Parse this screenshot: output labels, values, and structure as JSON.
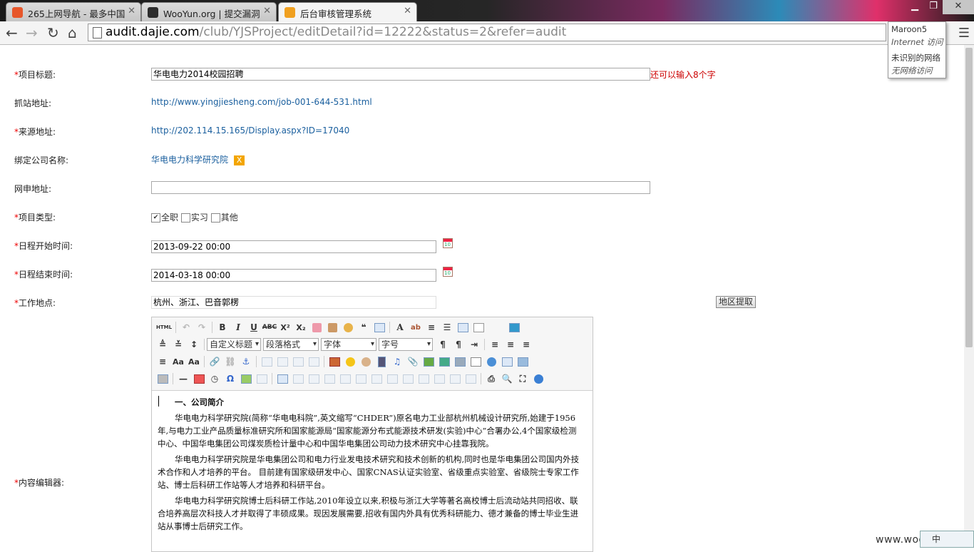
{
  "browser": {
    "tabs": [
      {
        "title": "265上网导航 - 最多中国",
        "favicon_color": "#e7562a"
      },
      {
        "title": "WooYun.org | 提交漏洞",
        "favicon_color": "#2c2c2c"
      },
      {
        "title": "后台审核管理系统",
        "favicon_color": "#f0a020"
      }
    ],
    "url_host": "audit.dajie.com",
    "url_path": "/club/YJSProject/editDetail?id=12222&status=2&refer=audit",
    "network_popup": {
      "line1": "Maroon5",
      "line2": "Internet 访问",
      "line3": "未识别的网络",
      "line4": "无网络访问"
    }
  },
  "form": {
    "title": {
      "label": "项目标题:",
      "value": "华电电力2014校园招聘",
      "hint": "还可以输入8个字"
    },
    "crawl": {
      "label": "抓站地址:",
      "value": "http://www.yingjiesheng.com/job-001-644-531.html"
    },
    "source": {
      "label": "来源地址:",
      "value": "http://202.114.15.165/Display.aspx?ID=17040"
    },
    "company": {
      "label": "绑定公司名称:",
      "value": "华电电力科学研究院",
      "remove": "X"
    },
    "apply": {
      "label": "网申地址:",
      "value": ""
    },
    "type": {
      "label": "项目类型:",
      "options": [
        {
          "label": "全职",
          "checked": true
        },
        {
          "label": "实习",
          "checked": false
        },
        {
          "label": "其他",
          "checked": false
        }
      ]
    },
    "start": {
      "label": "日程开始时间:",
      "value": "2013-09-22 00:00"
    },
    "end": {
      "label": "日程结束时间:",
      "value": "2014-03-18 00:00"
    },
    "location": {
      "label": "工作地点:",
      "value": "杭州、浙江、巴音郭楞",
      "button": "地区提取"
    },
    "content": {
      "label": "内容编辑器:"
    }
  },
  "editor": {
    "selects": [
      "自定义标题",
      "段落格式",
      "字体",
      "字号"
    ],
    "html_label": "HTML",
    "heading": "一、公司简介",
    "paragraphs": [
      "华电电力科学研究院(简称“华电电科院”,英文缩写“CHDER”)原名电力工业部杭州机械设计研究所,始建于1956年,与电力工业产品质量标准研究所和国家能源局“国家能源分布式能源技术研发(实验)中心”合署办公,4个国家级检测中心、中国华电集团公司煤炭质检计量中心和中国华电集团公司动力技术研究中心挂靠我院。",
      "华电电力科学研究院是华电集团公司和电力行业发电技术研究和技术创新的机构,同时也是华电集团公司国内外技术合作和人才培养的平台。 目前建有国家级研发中心、国家CNAS认证实验室、省级重点实验室、省级院士专家工作站、博士后科研工作站等人才培养和科研平台。",
      "华电电力科学研究院博士后科研工作站,2010年设立以来,积极与浙江大学等著名高校博士后流动站共同招收、联合培养高层次科技人才并取得了丰硕成果。现因发展需要,招收有国内外具有优秀科研能力、德才兼备的博士毕业生进站从事博士后研究工作。"
    ]
  },
  "watermark": "www.wooyun.org",
  "tray_text": "中"
}
